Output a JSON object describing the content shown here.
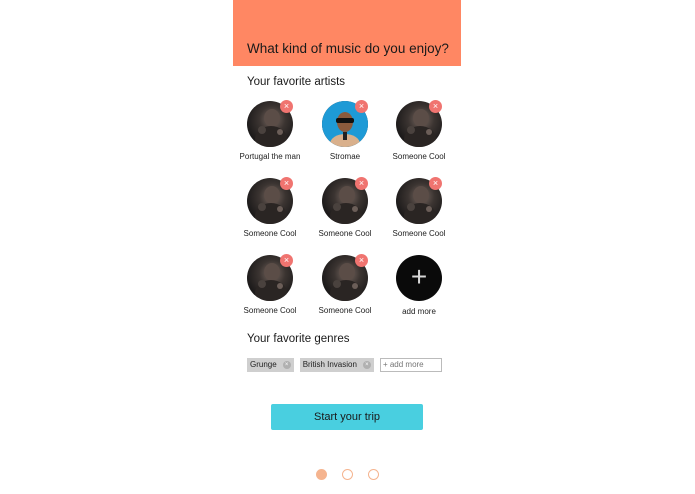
{
  "header": {
    "title": "What kind of music do you enjoy?"
  },
  "artists_section": {
    "title": "Your favorite artists",
    "artists": [
      {
        "name": "Portugal the man",
        "photo": "dark"
      },
      {
        "name": "Stromae",
        "photo": "stromae"
      },
      {
        "name": "Someone Cool",
        "photo": "dark"
      },
      {
        "name": "Someone Cool",
        "photo": "dark"
      },
      {
        "name": "Someone Cool",
        "photo": "dark"
      },
      {
        "name": "Someone Cool",
        "photo": "dark"
      },
      {
        "name": "Someone Cool",
        "photo": "dark"
      },
      {
        "name": "Someone Cool",
        "photo": "dark"
      }
    ],
    "remove_icon": "×",
    "add_more": {
      "label": "add more",
      "icon": "+"
    }
  },
  "genres_section": {
    "title": "Your favorite genres",
    "genres": [
      "Grunge",
      "British Invasion"
    ],
    "remove_icon": "×",
    "add_placeholder": "+ add more"
  },
  "start_button": {
    "label": "Start your trip"
  },
  "pagination": {
    "pages": 3,
    "active": 1
  },
  "colors": {
    "header": "#ff8763",
    "button": "#49cfe0",
    "remove": "#f07470",
    "dots": "#f5b48f"
  }
}
